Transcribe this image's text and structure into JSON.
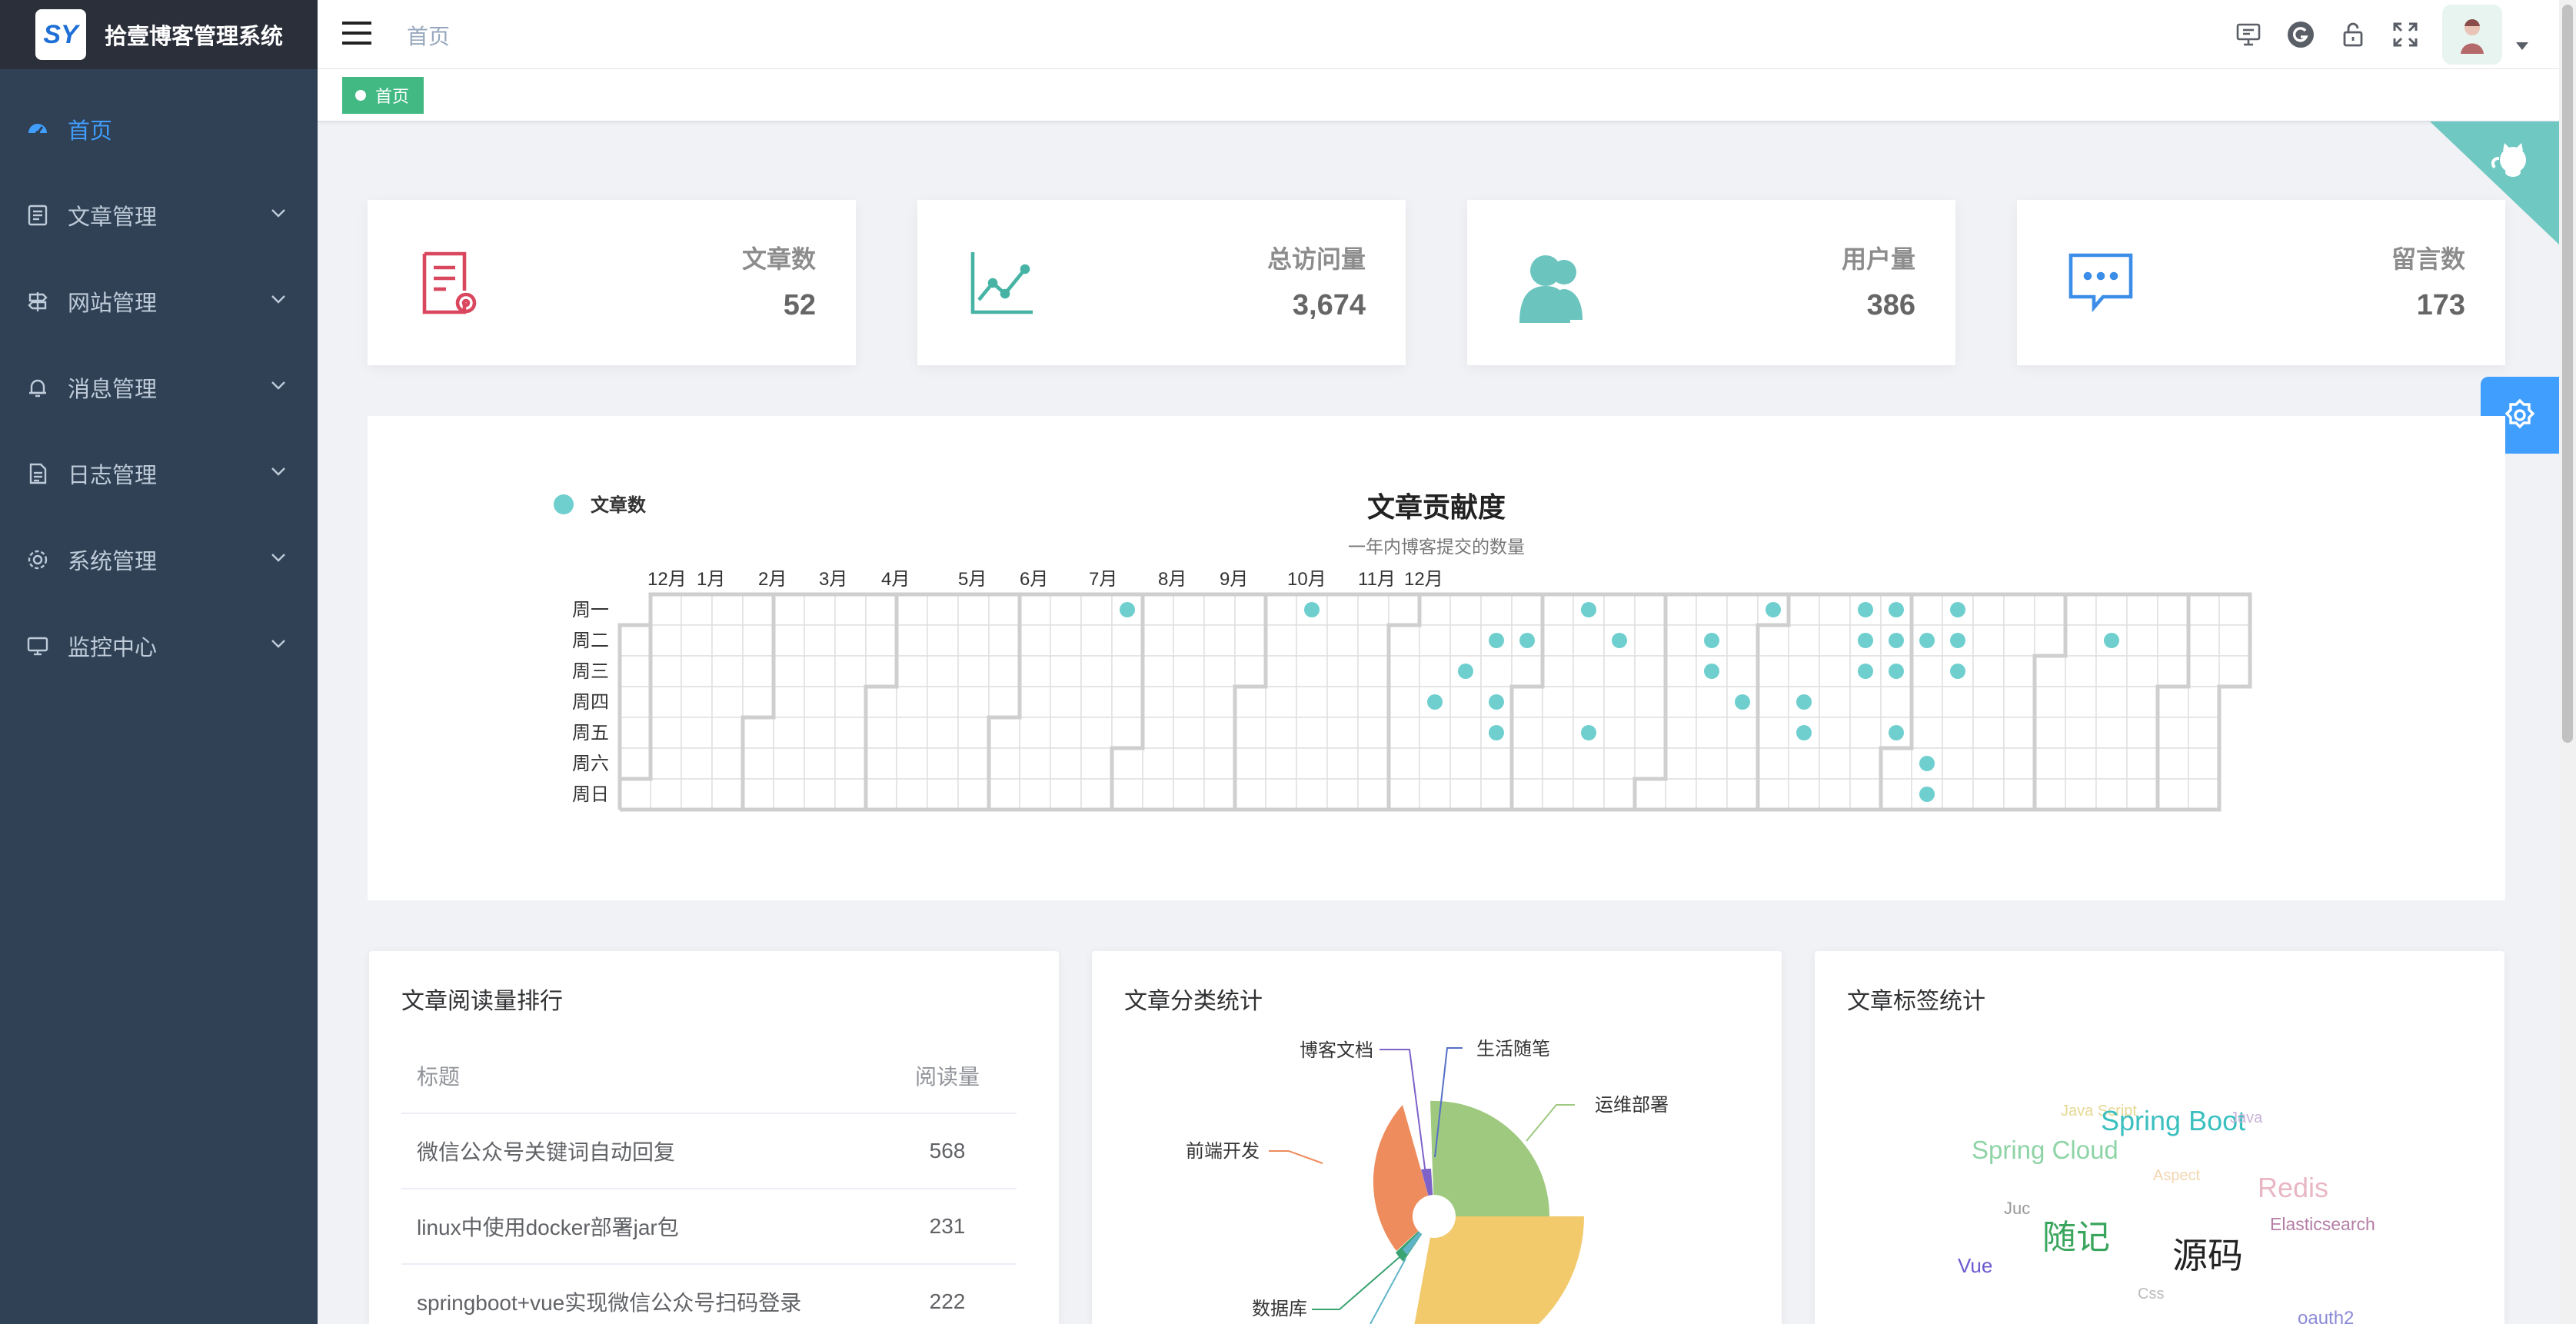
{
  "app": {
    "title": "拾壹博客管理系统",
    "logo_text": "SY"
  },
  "sidebar": {
    "items": [
      {
        "label": "首页",
        "icon": "dashboard-icon",
        "active": true,
        "expandable": false
      },
      {
        "label": "文章管理",
        "icon": "document-icon",
        "expandable": true
      },
      {
        "label": "网站管理",
        "icon": "signpost-icon",
        "expandable": true
      },
      {
        "label": "消息管理",
        "icon": "bell-icon",
        "expandable": true
      },
      {
        "label": "日志管理",
        "icon": "log-icon",
        "expandable": true
      },
      {
        "label": "系统管理",
        "icon": "gear-icon",
        "expandable": true
      },
      {
        "label": "监控中心",
        "icon": "monitor-icon",
        "expandable": true
      }
    ]
  },
  "navbar": {
    "breadcrumb": "首页",
    "icons": [
      "screen-icon",
      "git-icon",
      "lock-icon",
      "fullscreen-icon"
    ]
  },
  "tags_view": {
    "tags": [
      {
        "label": "首页",
        "active": true
      }
    ]
  },
  "stats": [
    {
      "label": "文章数",
      "value": "52",
      "icon": "article-stat-icon",
      "color": "#d9475e"
    },
    {
      "label": "总访问量",
      "value": "3,674",
      "icon": "chart-line-icon",
      "color": "#46b3a4"
    },
    {
      "label": "用户量",
      "value": "386",
      "icon": "users-icon",
      "color": "#6cc4bf"
    },
    {
      "label": "留言数",
      "value": "173",
      "icon": "message-icon",
      "color": "#3b8de8"
    }
  ],
  "contribution": {
    "title": "文章贡献度",
    "subtitle": "一年内博客提交的数量",
    "legend": "文章数",
    "dot_color": "#6fcfcf",
    "months": [
      "12月",
      "1月",
      "2月",
      "3月",
      "4月",
      "5月",
      "6月",
      "7月",
      "8月",
      "9月",
      "10月",
      "11月",
      "12月"
    ],
    "weekdays": [
      "周一",
      "周二",
      "周三",
      "周四",
      "周五",
      "周六",
      "周日"
    ]
  },
  "reading_rank": {
    "title": "文章阅读量排行",
    "columns": [
      "标题",
      "阅读量"
    ],
    "rows": [
      {
        "title": "微信公众号关键词自动回复",
        "views": "568"
      },
      {
        "title": "linux中使用docker部署jar包",
        "views": "231"
      },
      {
        "title": "springboot+vue实现微信公众号扫码登录",
        "views": "222"
      }
    ]
  },
  "category_stats": {
    "title": "文章分类统计",
    "labels": {
      "doc": "博客文档",
      "life": "生活随笔",
      "ops": "运维部署",
      "frontend": "前端开发",
      "db": "数据库"
    },
    "colors": {
      "ops": "#9ec97f",
      "frontend": "#ee8c5d",
      "backend": "#f2c96b",
      "doc": "#7e62c8",
      "db": "#3ba272",
      "teal": "#60b4c8"
    }
  },
  "tag_stats": {
    "title": "文章标签统计",
    "words": [
      "Java Script",
      "Spring Boot",
      "Java",
      "Spring Cloud",
      "Aspect",
      "Redis",
      "Juc",
      "随记",
      "Elasticsearch",
      "Vue",
      "源码",
      "Css",
      "oauth2"
    ]
  }
}
